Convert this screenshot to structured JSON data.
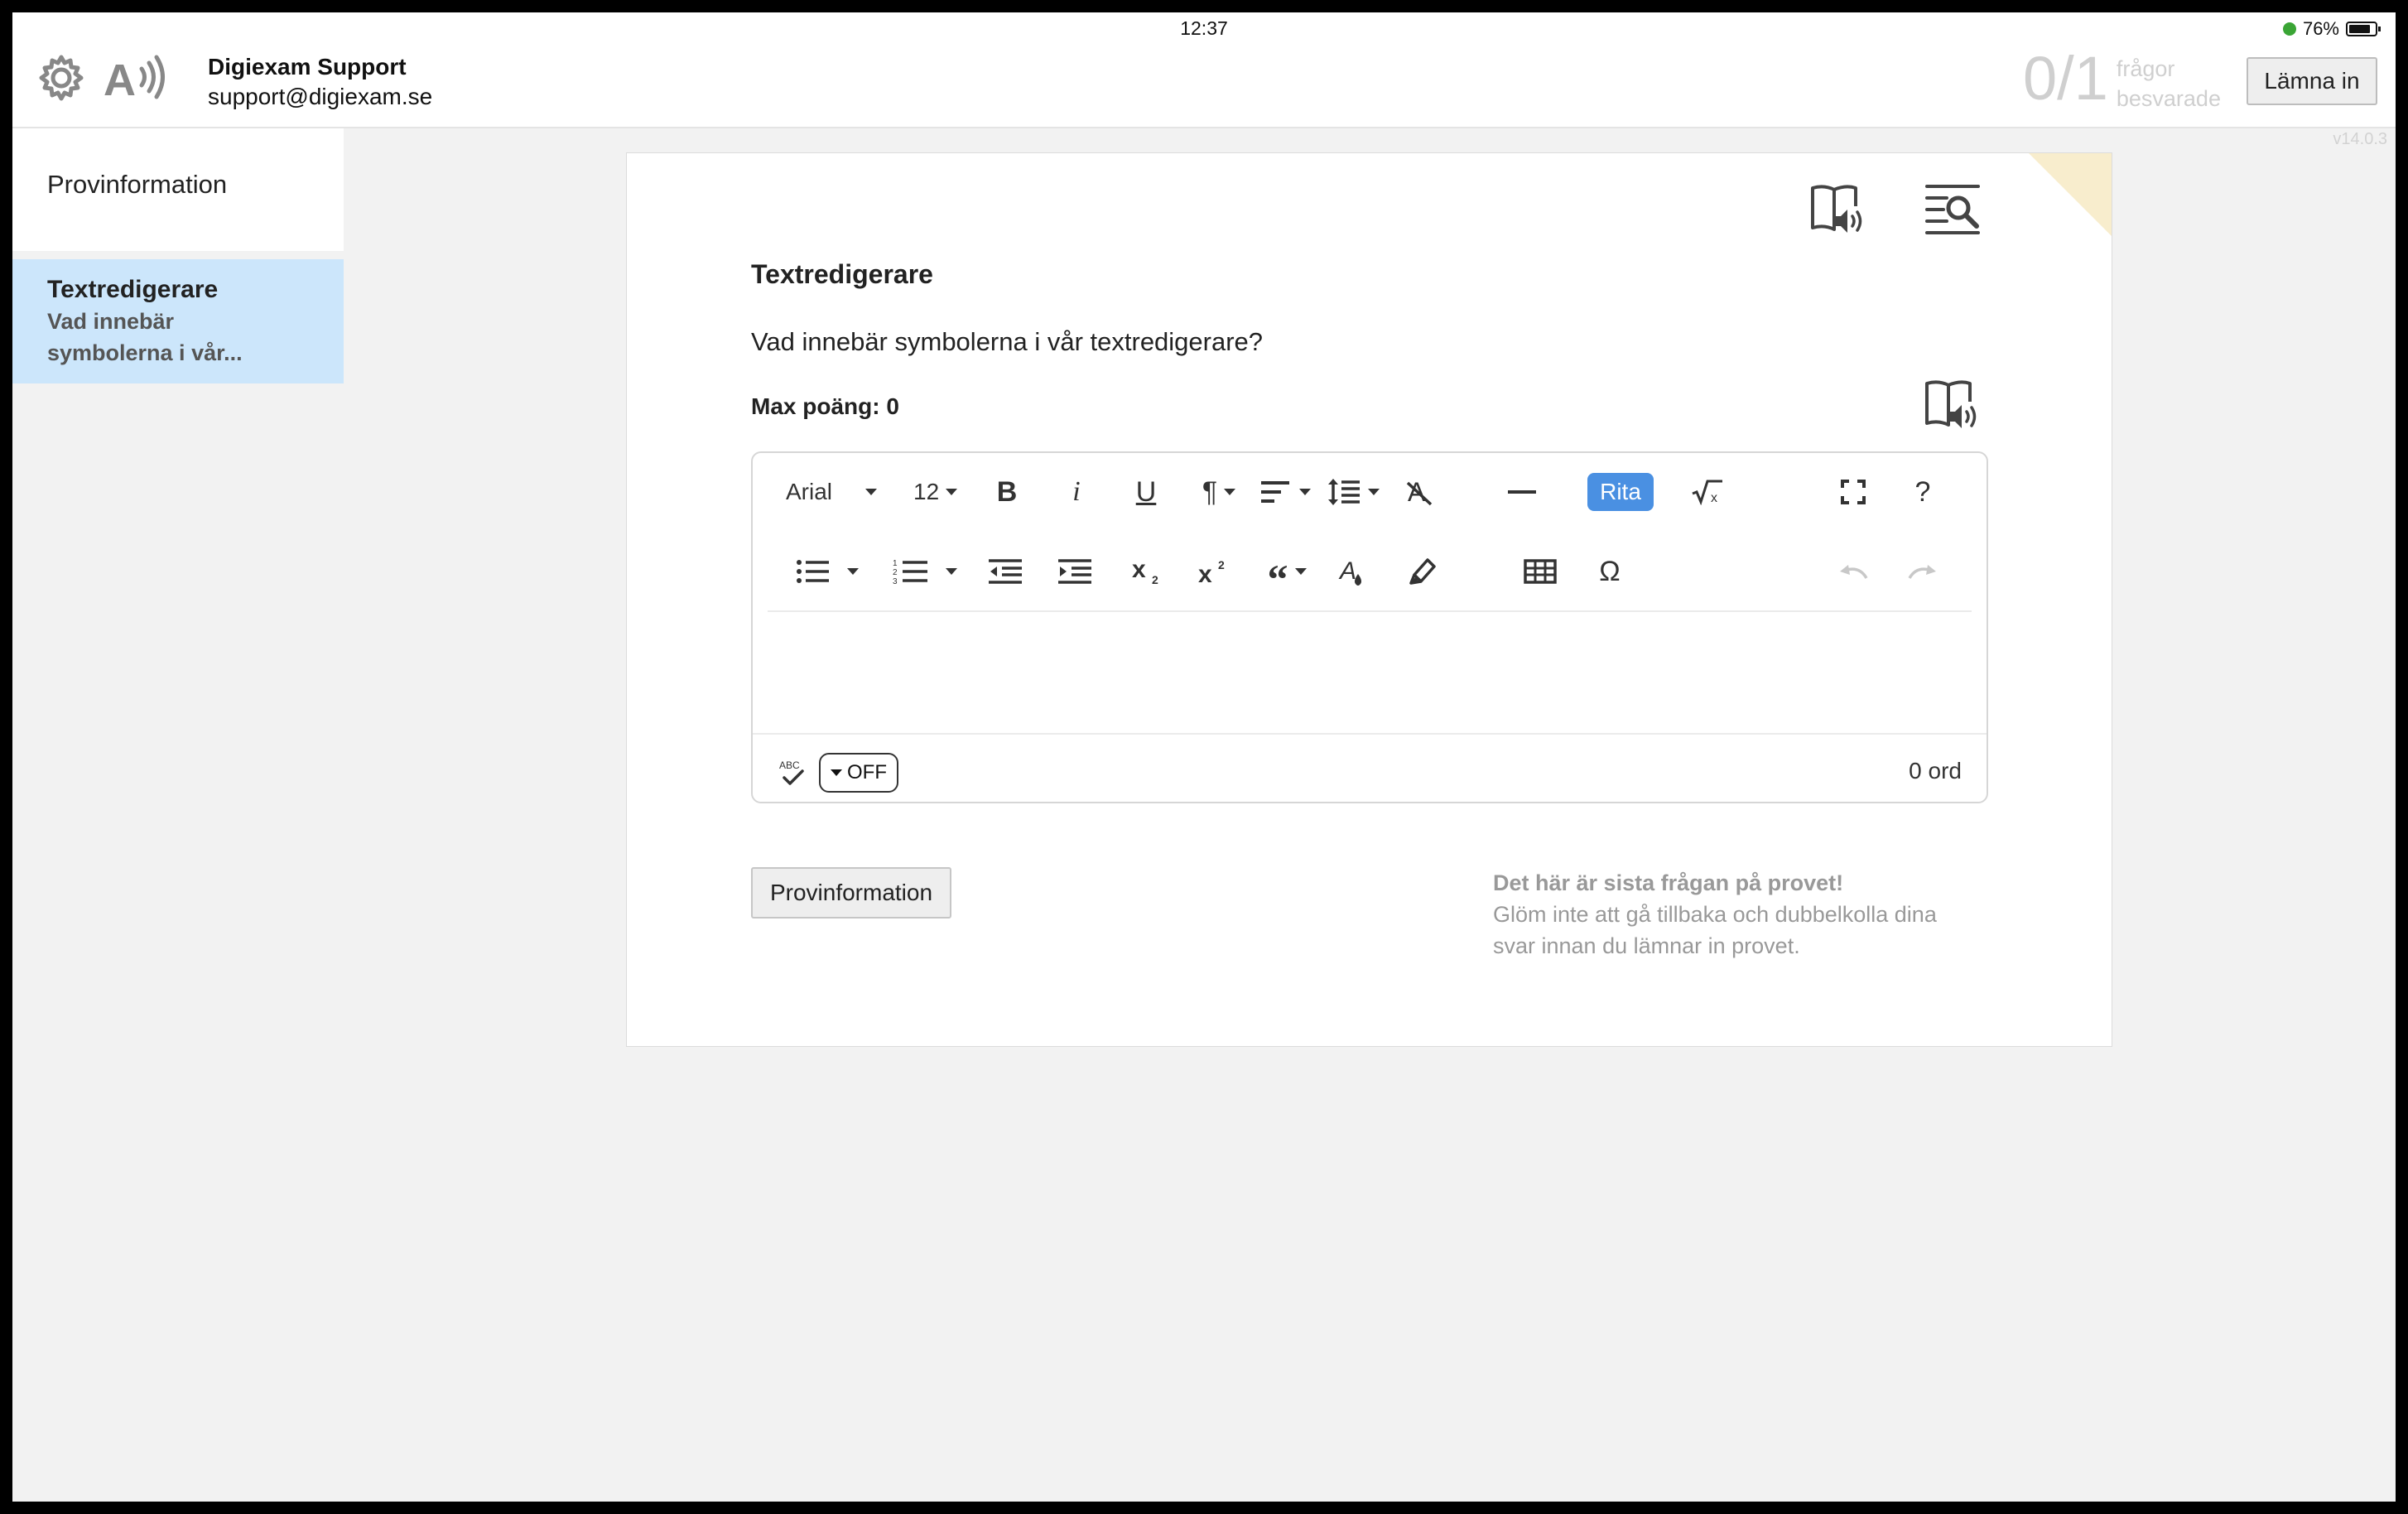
{
  "status": {
    "time": "12:37",
    "battery": "76%"
  },
  "header": {
    "user_name": "Digiexam Support",
    "user_email": "support@digiexam.se",
    "progress_count": "0/1",
    "progress_label_line1": "frågor",
    "progress_label_line2": "besvarade",
    "submit_label": "Lämna in",
    "version": "v14.0.3"
  },
  "sidebar": {
    "info_label": "Provinformation",
    "items": [
      {
        "title": "Textredigerare",
        "subtitle": "Vad innebär symbolerna i vår..."
      }
    ]
  },
  "question": {
    "title": "Textredigerare",
    "text": "Vad innebär symbolerna i vår textredigerare?",
    "max_points": "Max poäng: 0"
  },
  "editor": {
    "font_family": "Arial",
    "font_size": "12",
    "draw_label": "Rita",
    "help_label": "?",
    "spellcheck_state": "OFF",
    "word_count": "0 ord"
  },
  "footer": {
    "nav_button": "Provinformation",
    "last_question_title": "Det här är sista frågan på provet!",
    "last_question_text": "Glöm inte att gå tillbaka och dubbelkolla dina svar innan du lämnar in provet."
  },
  "colors": {
    "accent": "#4a90e2",
    "selected_item_bg": "#cce6fb",
    "fold": "#f8edcd"
  }
}
